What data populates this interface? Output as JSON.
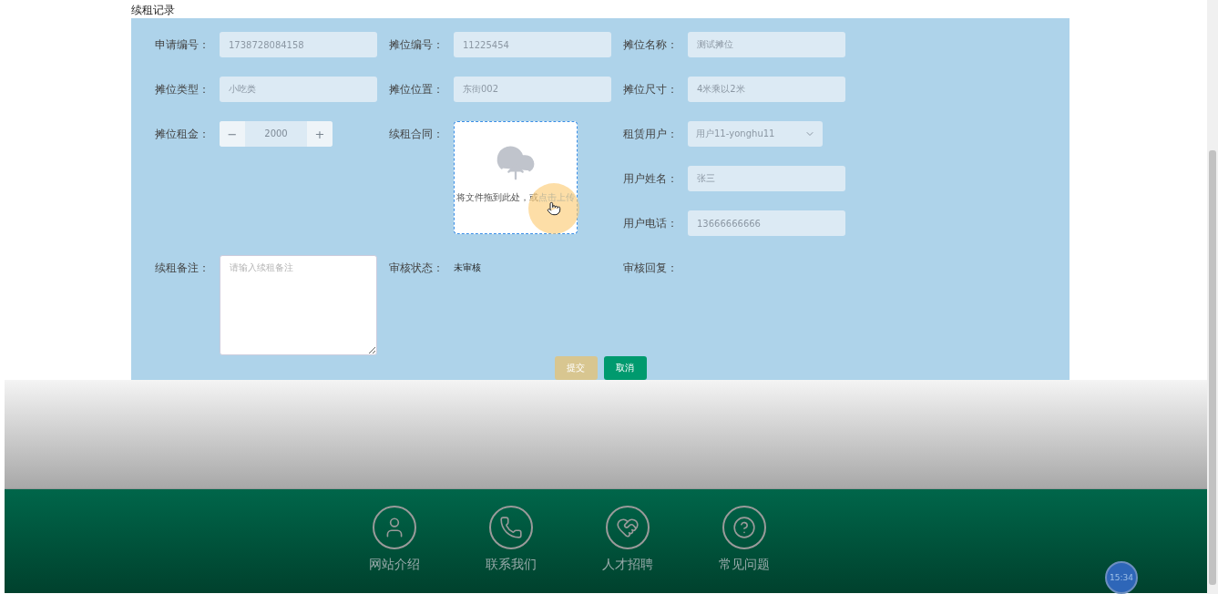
{
  "page_title": "续租记录",
  "form": {
    "fields": [
      {
        "kind": "text",
        "label": "申请编号：",
        "value": "1738728084158"
      },
      {
        "kind": "text",
        "label": "摊位编号：",
        "value": "11225454"
      },
      {
        "kind": "text",
        "label": "摊位名称：",
        "value": "测试摊位"
      },
      {
        "kind": "text",
        "label": "摊位类型：",
        "value": "小吃类"
      },
      {
        "kind": "text",
        "label": "摊位位置：",
        "value": "东街002"
      },
      {
        "kind": "text",
        "label": "摊位尺寸：",
        "value": "4米乘以2米"
      },
      {
        "kind": "number",
        "label": "摊位租金：",
        "value": "2000",
        "minus": "−",
        "plus": "+"
      },
      {
        "kind": "upload",
        "label": "续租合同：",
        "hint": "将文件拖到此处，或",
        "link": "点击上传"
      },
      {
        "kind": "select",
        "label": "租赁用户：",
        "value": "用户11-yonghu11"
      },
      {
        "kind": "text",
        "label": "用户姓名：",
        "value": "张三"
      },
      {
        "kind": "text",
        "label": "用户电话：",
        "value": "13666666666"
      },
      {
        "kind": "textarea",
        "label": "续租备注：",
        "placeholder": "请输入续租备注"
      },
      {
        "kind": "status",
        "label": "审核状态：",
        "value": "未审核"
      },
      {
        "kind": "status",
        "label": "审核回复："
      }
    ],
    "buttons": [
      {
        "kind": "submit",
        "label": "提交"
      },
      {
        "kind": "cancel",
        "label": "取消"
      }
    ]
  },
  "footer": {
    "items": [
      {
        "kind": "user",
        "label": "网站介绍"
      },
      {
        "kind": "phone",
        "label": "联系我们"
      },
      {
        "kind": "heart",
        "label": "人才招聘"
      },
      {
        "kind": "question",
        "label": "常见问题"
      }
    ]
  },
  "clock": "15:34"
}
